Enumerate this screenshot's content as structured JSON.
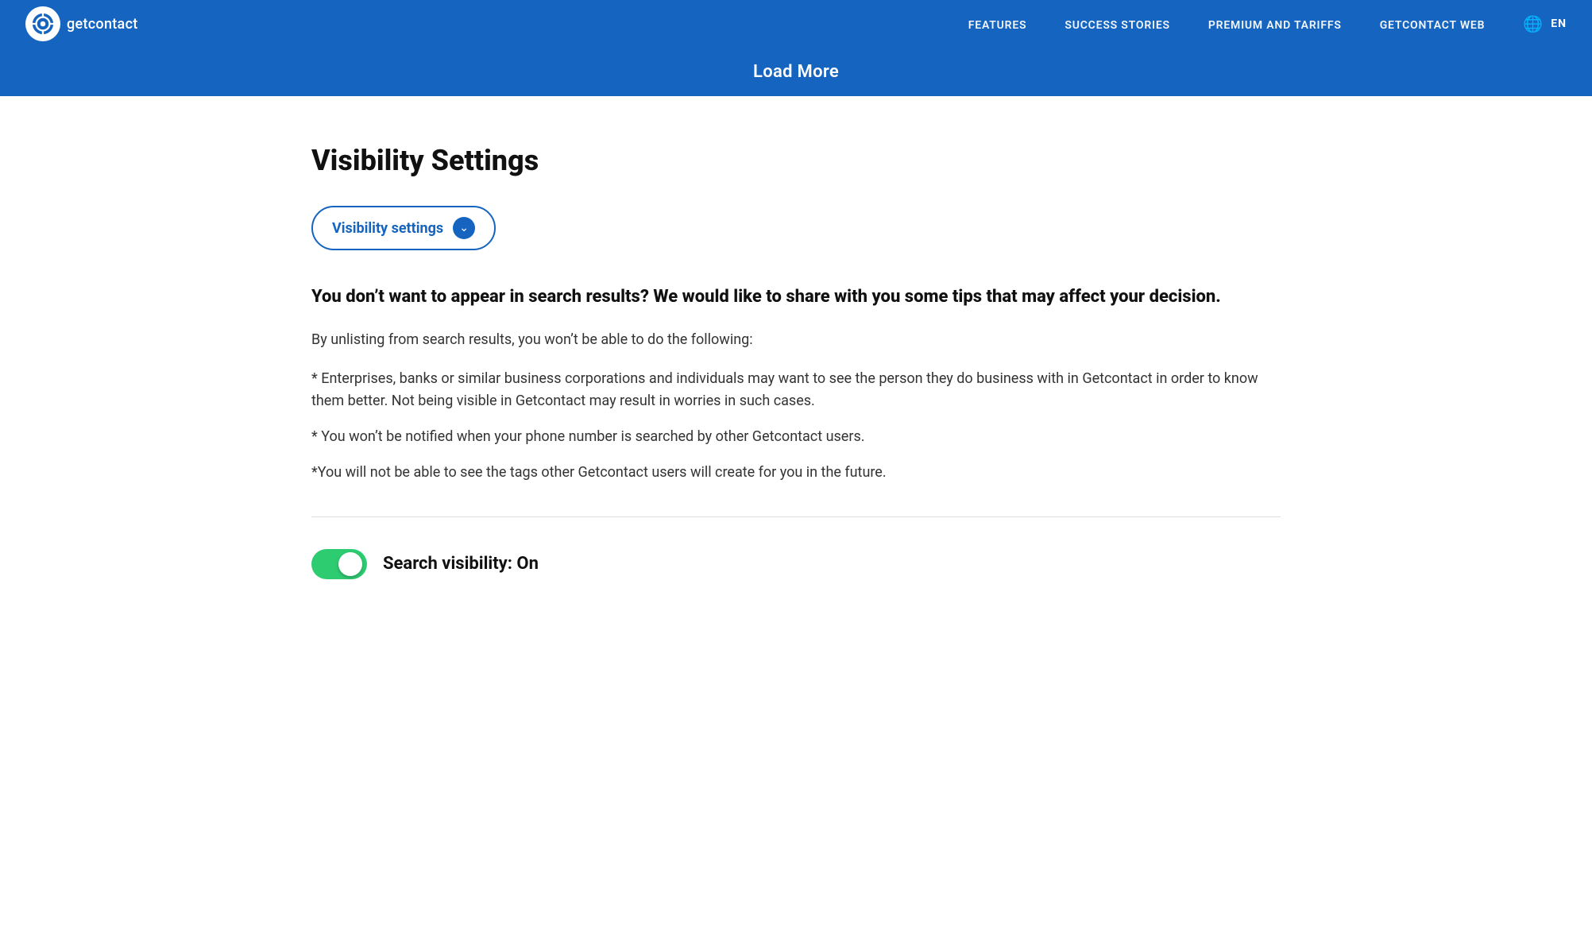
{
  "nav": {
    "logo_text": "getcontact",
    "links": [
      {
        "id": "features",
        "label": "FEATURES",
        "href": "#"
      },
      {
        "id": "success-stories",
        "label": "SUCCESS STORIES",
        "href": "#"
      },
      {
        "id": "premium-tariffs",
        "label": "PREMIUM AND TARIFFS",
        "href": "#"
      },
      {
        "id": "getcontact-web",
        "label": "GETCONTACT WEB",
        "href": "#"
      }
    ],
    "lang": "EN"
  },
  "load_more": {
    "label": "Load More"
  },
  "section": {
    "title": "Visibility Settings",
    "dropdown_btn_label": "Visibility settings",
    "info_heading": "You don’t want to appear in search results? We would like to share with you some tips that may affect your decision.",
    "intro_text": "By unlisting from search results, you won’t be able to do the following:",
    "bullets": [
      "* Enterprises, banks or similar business corporations and individuals may want to see the person they do business with in Getcontact in order to know them better. Not being visible in Getcontact may result in worries in such cases.",
      "* You won’t be notified when your phone number is searched by other Getcontact users.",
      "*You will not be able to see the tags other Getcontact users will create for you in the future."
    ],
    "toggle_label": "Search visibility: On",
    "toggle_on": true
  }
}
